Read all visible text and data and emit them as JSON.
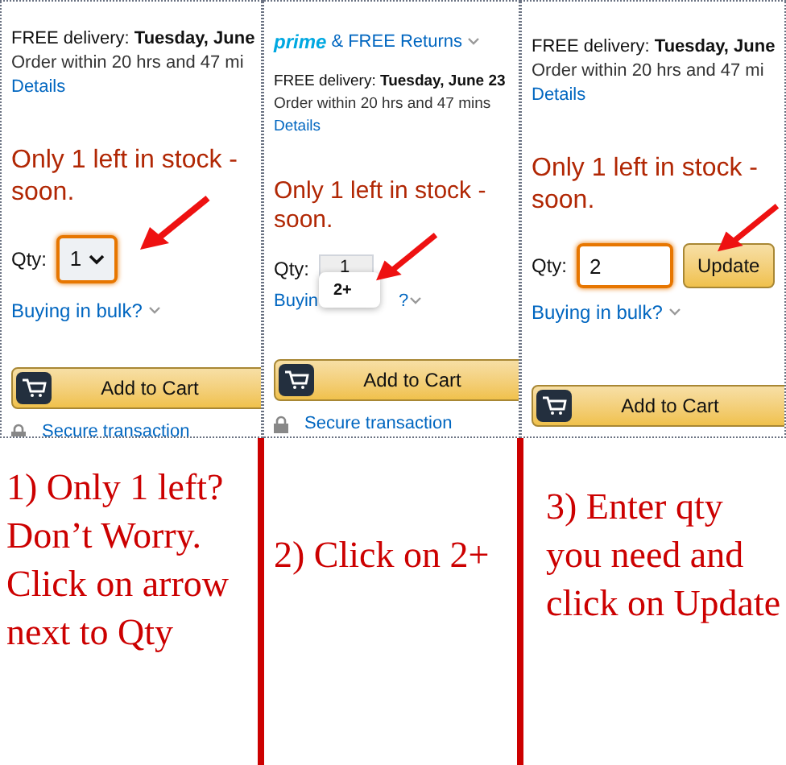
{
  "panels": [
    {
      "kind": "dropdown",
      "delivery_label": "FREE delivery:",
      "delivery_date": "Tuesday, June",
      "order_line": "Order within 20 hrs and 47 mi",
      "details": "Details",
      "stock": "Only 1 left in stock -",
      "stock_line2": "soon.",
      "qty_label": "Qty:",
      "qty_value": "1",
      "bulk": "Buying in bulk?",
      "add_to_cart": "Add to Cart",
      "secure": "Secure transaction"
    },
    {
      "kind": "open_list",
      "prime": "prime",
      "returns": "& FREE Returns",
      "delivery_label": "FREE delivery:",
      "delivery_date": "Tuesday, June 23",
      "order_line": "Order within 20 hrs and 47 mins",
      "details": "Details",
      "stock": "Only 1 left in stock -",
      "stock_line2": "soon.",
      "qty_label": "Qty:",
      "qty_value": "1",
      "option": "2+",
      "bulk": "Buyin",
      "bulk_end": "?",
      "add_to_cart": "Add to Cart",
      "secure": "Secure transaction"
    },
    {
      "kind": "input",
      "delivery_label": "FREE delivery:",
      "delivery_date": "Tuesday, June",
      "order_line": "Order within 20 hrs and 47 mi",
      "details": "Details",
      "stock": "Only 1 left in stock -",
      "stock_line2": "soon.",
      "qty_label": "Qty:",
      "qty_value": "2",
      "update": "Update",
      "bulk": "Buying in bulk?",
      "add_to_cart": "Add to Cart"
    }
  ],
  "captions": [
    "1) Only 1 left? Don’t Worry. Click on arrow next to Qty",
    "2) Click on 2+",
    "3) Enter qty you need and click on Update"
  ]
}
